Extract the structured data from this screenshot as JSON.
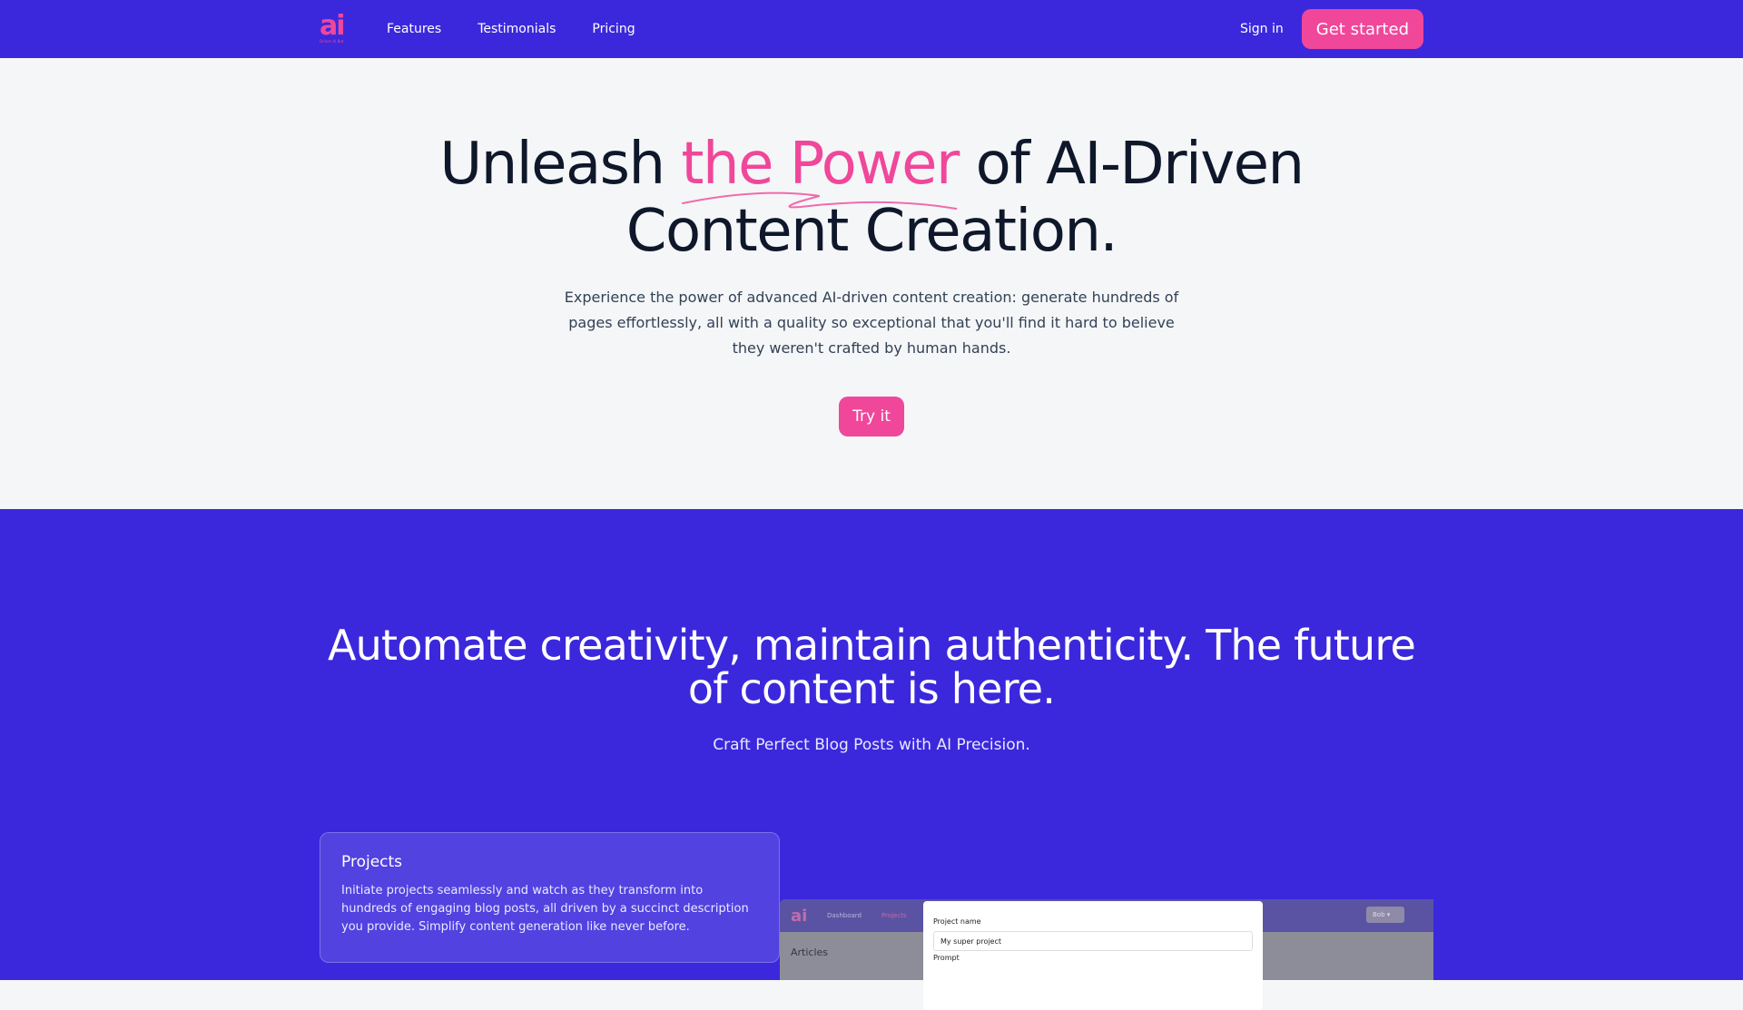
{
  "nav": {
    "logo": "ai",
    "logo_sub": "Driven Ai Bot",
    "links": [
      "Features",
      "Testimonials",
      "Pricing"
    ],
    "signin": "Sign in",
    "cta": "Get started"
  },
  "hero": {
    "title_before": "Unleash ",
    "title_accent": "the Power",
    "title_after": " of AI-Driven Content Creation.",
    "description": "Experience the power of advanced AI-driven content creation: generate hundreds of pages effortlessly, all with a quality so exceptional that you'll find it hard to believe they weren't crafted by human hands.",
    "button": "Try it"
  },
  "feature": {
    "heading": "Automate creativity, maintain authenticity. The future of content is here.",
    "subheading": "Craft Perfect Blog Posts with AI Precision.",
    "card": {
      "title": "Projects",
      "text": "Initiate projects seamlessly and watch as they transform into hundreds of engaging blog posts, all driven by a succinct description you provide. Simplify content generation like never before."
    },
    "mock": {
      "logo": "ai",
      "nav_links": [
        "Dashboard",
        "Projects"
      ],
      "user": "Bob",
      "section_label": "Articles",
      "modal": {
        "project_name_label": "Project name",
        "project_name_value": "My super project",
        "prompt_label": "Prompt"
      }
    }
  },
  "colors": {
    "brand": "#3b28dc",
    "accent": "#f0479a",
    "hero_bg": "#f4f6f8"
  }
}
